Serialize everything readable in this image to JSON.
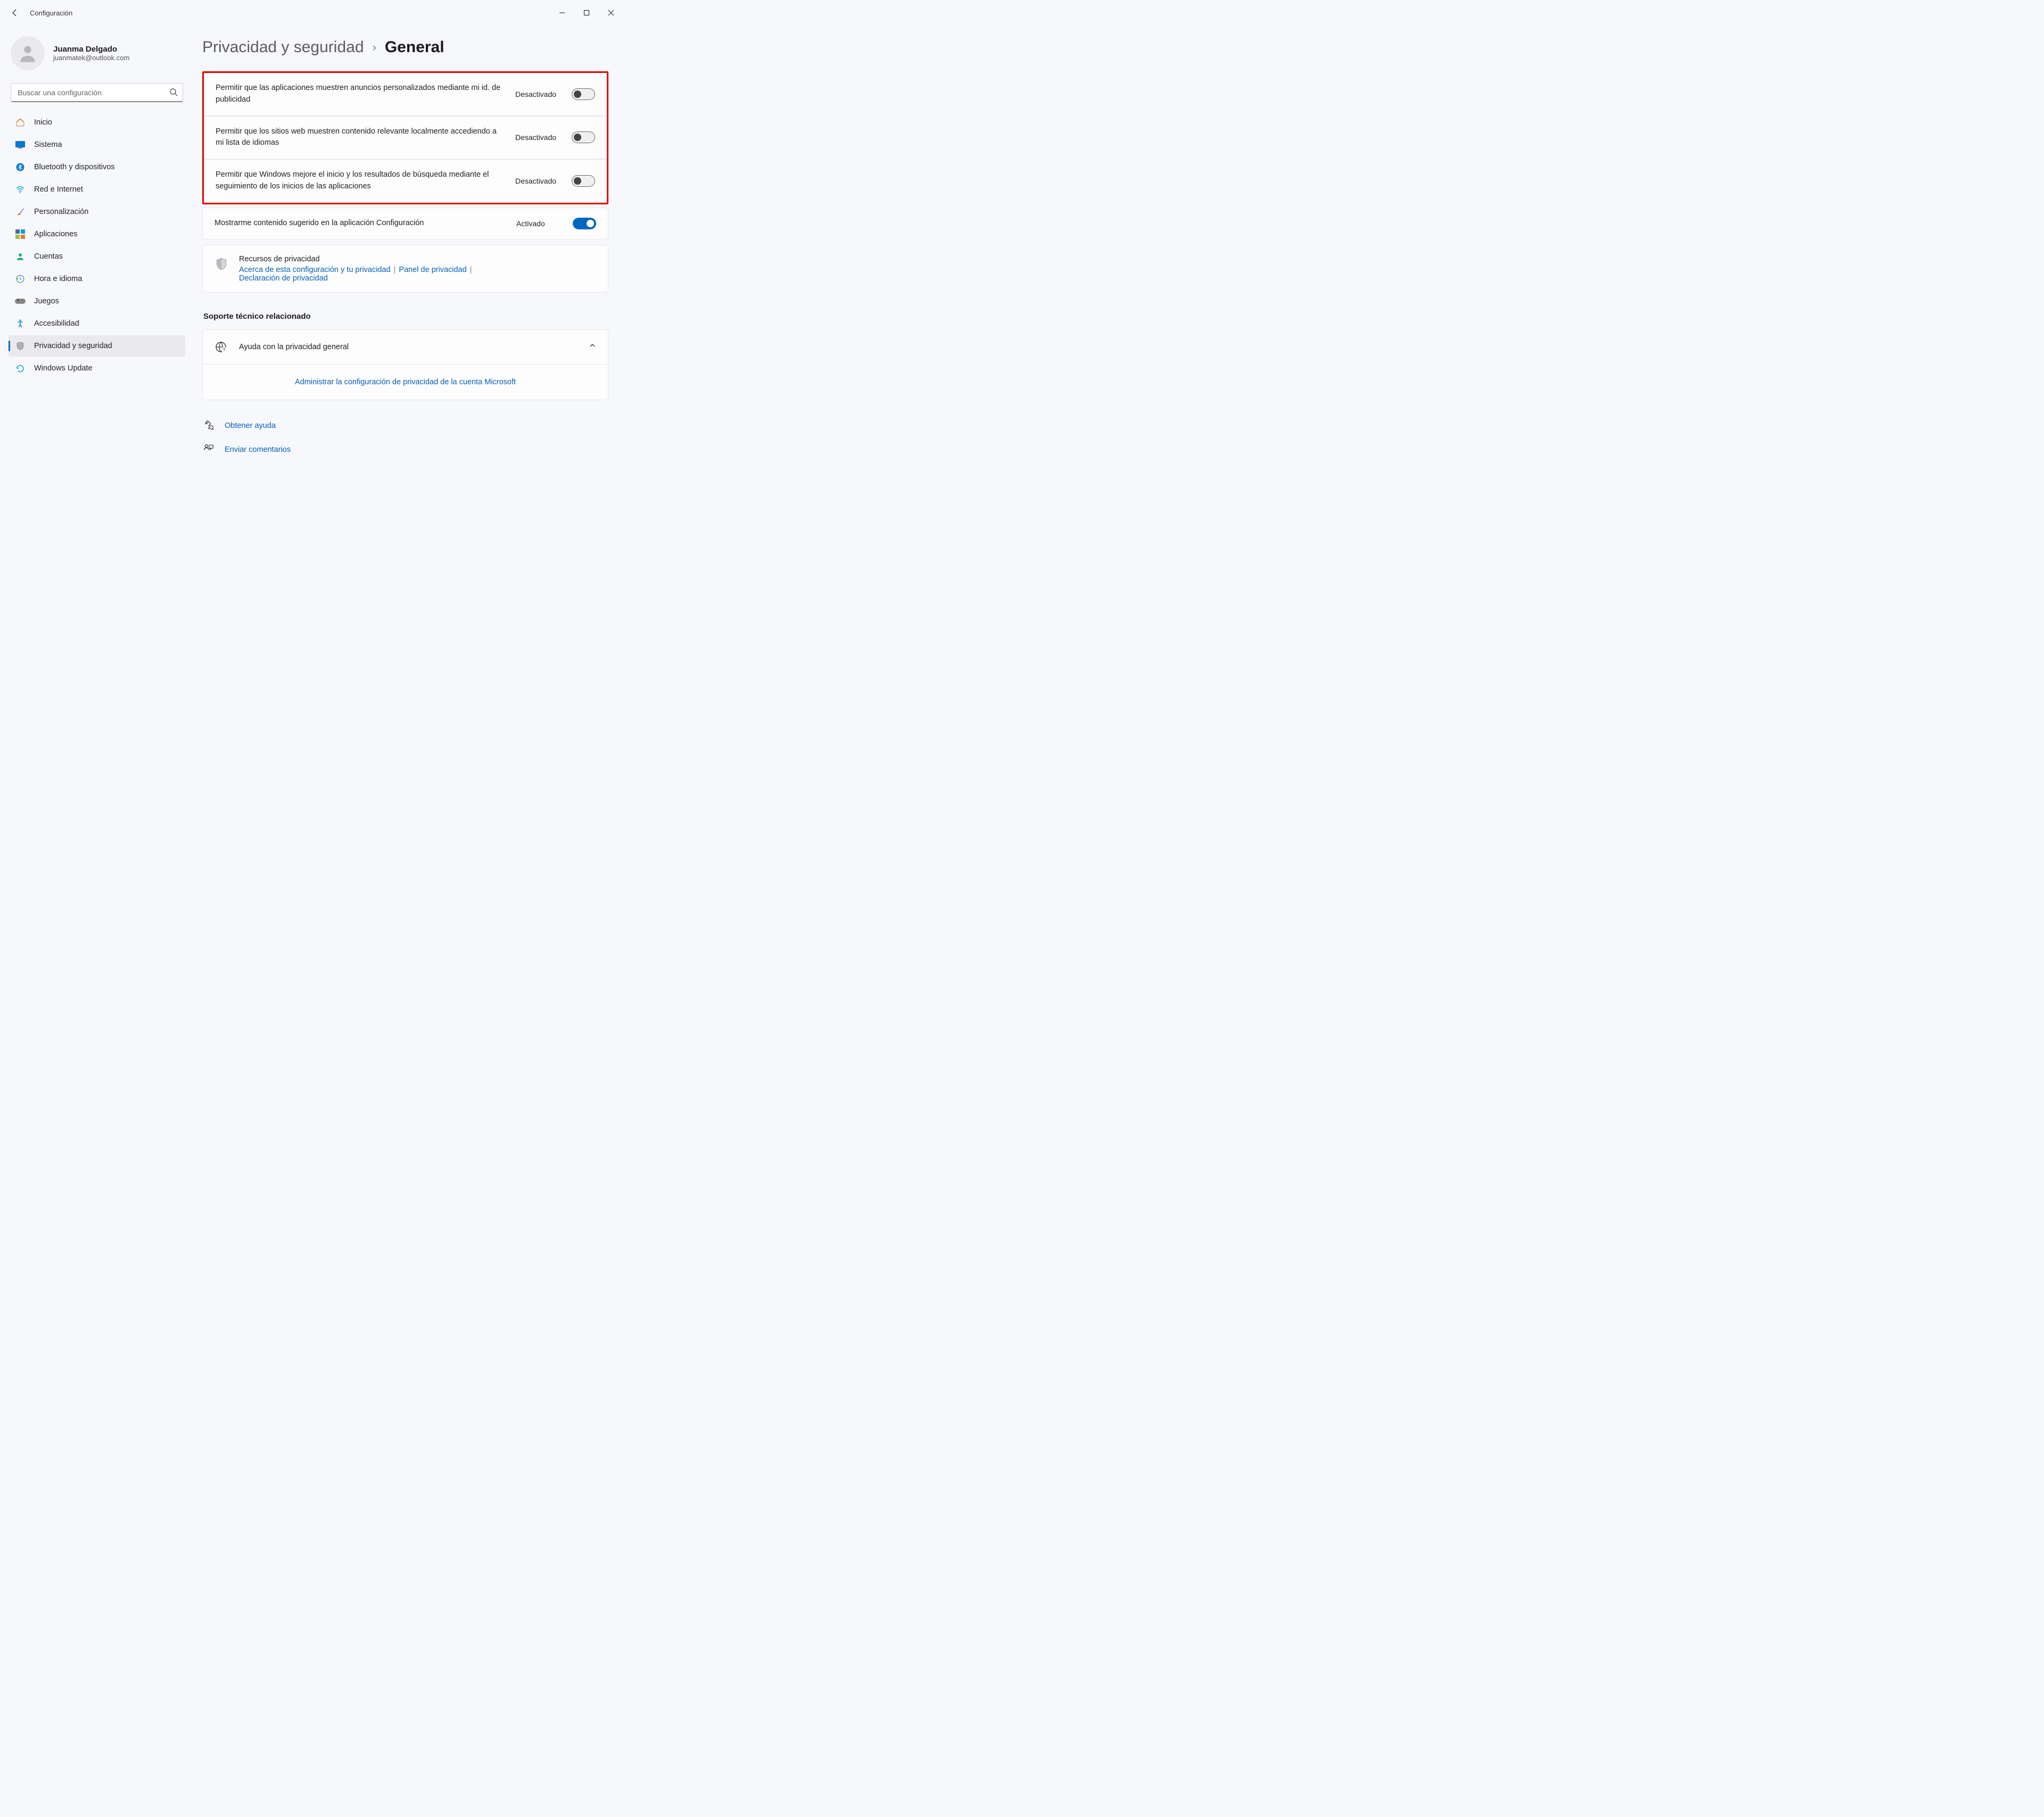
{
  "app": {
    "title": "Configuración"
  },
  "user": {
    "name": "Juanma Delgado",
    "email": "juanmatek@outlook.com"
  },
  "search": {
    "placeholder": "Buscar una configuración"
  },
  "nav": {
    "items": [
      {
        "label": "Inicio"
      },
      {
        "label": "Sistema"
      },
      {
        "label": "Bluetooth y dispositivos"
      },
      {
        "label": "Red e Internet"
      },
      {
        "label": "Personalización"
      },
      {
        "label": "Aplicaciones"
      },
      {
        "label": "Cuentas"
      },
      {
        "label": "Hora e idioma"
      },
      {
        "label": "Juegos"
      },
      {
        "label": "Accesibilidad"
      },
      {
        "label": "Privacidad y seguridad"
      },
      {
        "label": "Windows Update"
      }
    ],
    "active_index": 10
  },
  "breadcrumb": {
    "parent": "Privacidad y seguridad",
    "current": "General"
  },
  "settings": [
    {
      "label": "Permitir que las aplicaciones muestren anuncios personalizados mediante mi id. de publicidad",
      "state": "Desactivado",
      "on": false
    },
    {
      "label": "Permitir que los sitios web muestren contenido relevante localmente accediendo a mi lista de idiomas",
      "state": "Desactivado",
      "on": false
    },
    {
      "label": "Permitir que Windows mejore el inicio y los resultados de búsqueda mediante el seguimiento de los inicios de las aplicaciones",
      "state": "Desactivado",
      "on": false
    },
    {
      "label": "Mostrarme contenido sugerido en la aplicación Configuración",
      "state": "Activado",
      "on": true
    }
  ],
  "resources": {
    "title": "Recursos de privacidad",
    "link1": "Acerca de esta configuración y tu privacidad",
    "link2": "Panel de privacidad",
    "link3": "Declaración de privacidad"
  },
  "support": {
    "heading": "Soporte técnico relacionado",
    "item_title": "Ayuda con la privacidad general",
    "item_link": "Administrar la configuración de privacidad de la cuenta Microsoft"
  },
  "footer": {
    "help": "Obtener ayuda",
    "feedback": "Enviar comentarios"
  }
}
